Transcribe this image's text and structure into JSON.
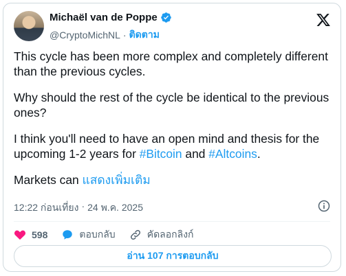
{
  "author": {
    "name": "Michaël van de Poppe",
    "handle": "@CryptoMichNL",
    "separator": "·",
    "follow_label": "ติดตาม"
  },
  "tweet": {
    "para1": "This cycle has been more complex and completely different than the previous cycles.",
    "para2": "Why should the rest of the cycle be identical to the previous ones?",
    "para3_before": "I think you'll need to have an open mind and thesis for the upcoming 1-2 years for ",
    "hashtag1": "#Bitcoin",
    "para3_mid": " and ",
    "hashtag2": "#Altcoins",
    "para3_end": ".",
    "para4_text": "Markets can ",
    "show_more": "แสดงเพิ่มเติม"
  },
  "meta": {
    "time": "12:22 ก่อนเที่ยง",
    "separator": "·",
    "date": "24 พ.ค. 2025"
  },
  "actions": {
    "like_count": "598",
    "reply_label": "ตอบกลับ",
    "copy_link_label": "คัดลอกลิงก์"
  },
  "read_replies_label": "อ่าน 107 การตอบกลับ",
  "icons": {
    "verified": "verified-badge-icon",
    "x_logo": "x-logo-icon",
    "info": "info-icon",
    "like": "heart-icon",
    "reply": "speech-bubble-icon",
    "link": "link-icon"
  },
  "colors": {
    "accent": "#1d9bf0",
    "like": "#f91880",
    "text": "#0f1419",
    "muted": "#536471"
  }
}
